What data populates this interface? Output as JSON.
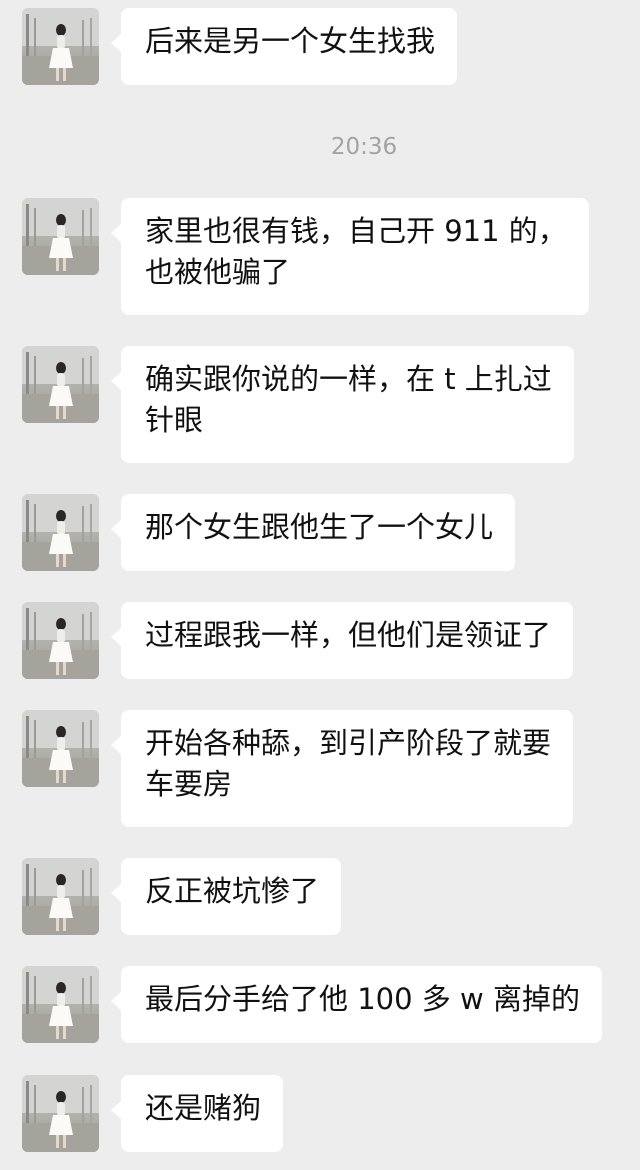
{
  "chat": {
    "timestamp": "20:36",
    "messages": [
      {
        "lines": [
          "后来是另一个女生找我"
        ]
      },
      {
        "lines": [
          "家里也很有钱，自己开 911 的，",
          "也被他骗了"
        ]
      },
      {
        "lines": [
          "确实跟你说的一样，在 t 上扎过",
          "针眼"
        ]
      },
      {
        "lines": [
          "那个女生跟他生了一个女儿"
        ]
      },
      {
        "lines": [
          "过程跟我一样，但他们是领证了"
        ]
      },
      {
        "lines": [
          "开始各种舔，到引产阶段了就要",
          "车要房"
        ]
      },
      {
        "lines": [
          "反正被坑惨了"
        ]
      },
      {
        "lines": [
          "最后分手给了他 100 多 w 离掉的"
        ]
      },
      {
        "lines": [
          "还是赌狗"
        ]
      }
    ]
  }
}
